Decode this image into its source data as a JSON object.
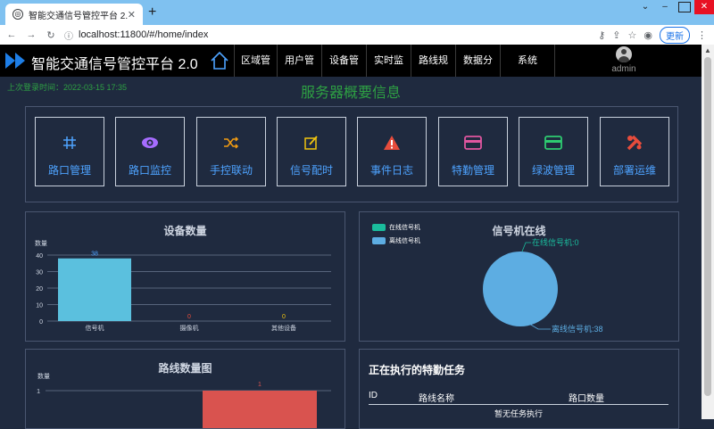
{
  "browser": {
    "tab_title": "智能交通信号管控平台 2.0",
    "url": "localhost:11800/#/home/index",
    "update_label": "更新"
  },
  "header": {
    "app_title": "智能交通信号管控平台 2.0",
    "menu": [
      {
        "label": "区域管理"
      },
      {
        "label": "用户管理"
      },
      {
        "label": "设备管理"
      },
      {
        "label": "实时监控"
      },
      {
        "label": "路线规划"
      },
      {
        "label": "数据分析"
      },
      {
        "label": "系统"
      }
    ],
    "user_name": "admin"
  },
  "page": {
    "welcome": "上次登录时间：2022-03-15 17:35",
    "title": "服务器概要信息"
  },
  "quick_links": [
    {
      "label": "路口管理",
      "icon": "hash-icon",
      "color": "#4ea3ff"
    },
    {
      "label": "路口监控",
      "icon": "eye-icon",
      "color": "#a66cff"
    },
    {
      "label": "手控联动",
      "icon": "shuffle-icon",
      "color": "#f39c12"
    },
    {
      "label": "信号配时",
      "icon": "edit-icon",
      "color": "#f1c40f"
    },
    {
      "label": "事件日志",
      "icon": "warning-icon",
      "color": "#e74c3c"
    },
    {
      "label": "特勤管理",
      "icon": "card-icon",
      "color": "#e056a0"
    },
    {
      "label": "绿波管理",
      "icon": "card-icon",
      "color": "#2ecc71"
    },
    {
      "label": "部署运维",
      "icon": "tools-icon",
      "color": "#e74c3c"
    }
  ],
  "chart_data": [
    {
      "type": "bar",
      "title": "设备数量",
      "ylabel": "数量",
      "categories": [
        "信号机",
        "摄像机",
        "其他设备"
      ],
      "values": [
        38,
        0,
        0
      ],
      "value_colors": [
        "#4ea3ff",
        "#e74c3c",
        "#f1c40f"
      ],
      "bar_color": "#5bc0de",
      "ylim": [
        0,
        40
      ],
      "yticks": [
        0,
        10,
        20,
        30,
        40
      ],
      "grid": true
    },
    {
      "type": "pie",
      "title": "信号机在线",
      "labels": [
        "在线信号机",
        "离线信号机"
      ],
      "values": [
        0,
        38
      ],
      "colors": [
        "#1abc9c",
        "#5dade2"
      ],
      "slice_labels": [
        "在线信号机:0",
        "离线信号机:38"
      ],
      "legend": "top-left"
    },
    {
      "type": "bar",
      "title": "路线数量图",
      "ylabel": "数量",
      "values": [
        1
      ],
      "bar_color": "#d9534f",
      "yticks": [
        1
      ],
      "grid": true
    }
  ],
  "tasks": {
    "title": "正在执行的特勤任务",
    "columns": [
      "ID",
      "路线名称",
      "路口数量"
    ],
    "empty_text": "暂无任务执行"
  }
}
